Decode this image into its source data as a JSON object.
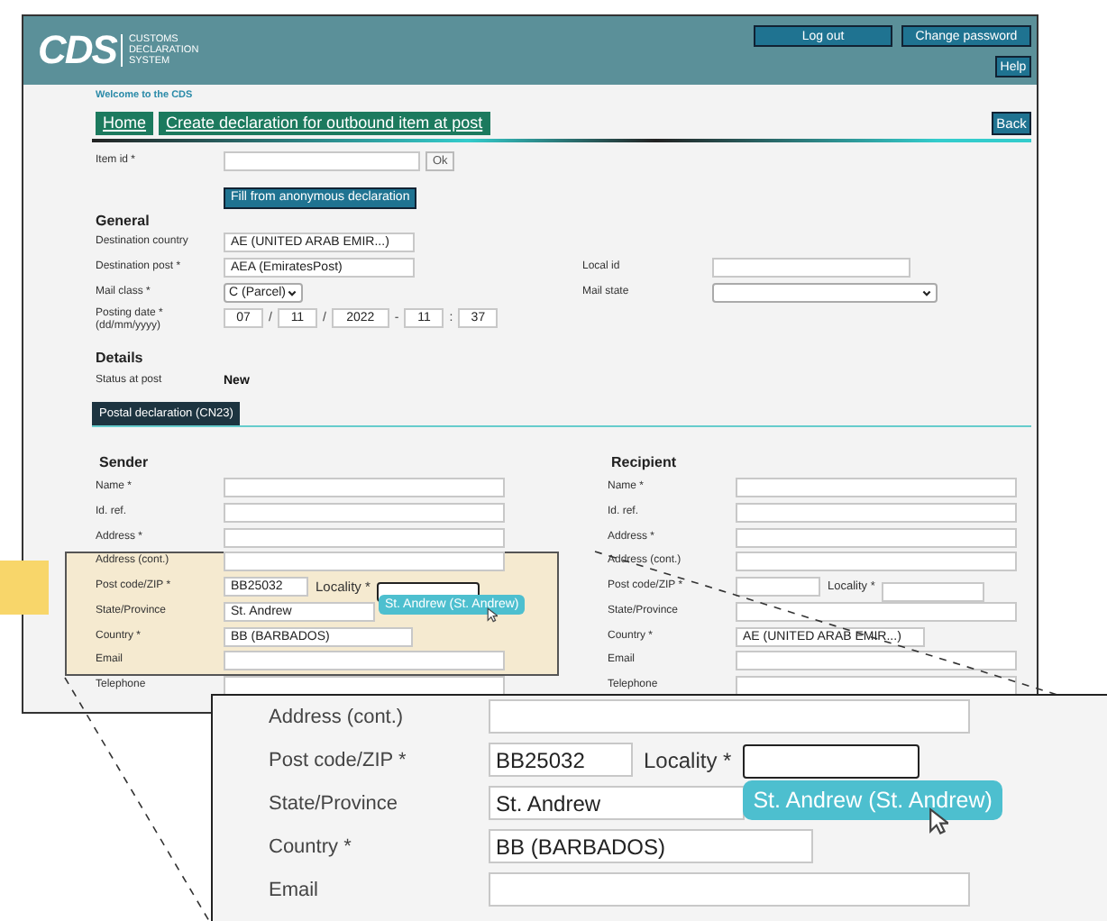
{
  "header": {
    "logo": "CDS",
    "logo_subtitle": [
      "CUSTOMS",
      "DECLARATION",
      "SYSTEM"
    ],
    "buttons": [
      "Log out",
      "Change password"
    ],
    "help": "Help"
  },
  "welcome": "Welcome to the CDS",
  "nav": {
    "links": [
      "Home",
      "Create declaration for outbound item at post"
    ],
    "back": "Back"
  },
  "item_id": {
    "label": "Item id *",
    "ok": "Ok",
    "fill_button": "Fill from anonymous declaration"
  },
  "general": {
    "heading": "General",
    "fields": [
      {
        "kind": "text",
        "label": "Destination country",
        "value": "AE (UNITED ARAB EMIR...)"
      },
      {
        "kind": "text",
        "label": "Destination post *",
        "value": "AEA (EmiratesPost)"
      },
      {
        "kind": "select",
        "label": "Mail class *",
        "value": "C (Parcel)"
      }
    ],
    "posting_date": {
      "label": "Posting date *",
      "hint": "(dd/mm/yyyy)",
      "parts": [
        "07",
        "11",
        "2022",
        "11",
        "37"
      ],
      "separators": [
        "/",
        "/",
        "-",
        ":"
      ]
    },
    "right_fields": [
      {
        "kind": "text",
        "label": "Local id"
      },
      {
        "kind": "select",
        "label": "Mail state"
      }
    ]
  },
  "details": {
    "heading": "Details",
    "status_label": "Status at post",
    "status": "New"
  },
  "tabs": [
    {
      "label": "Postal declaration (CN23)",
      "selected": true
    }
  ],
  "sender": {
    "heading": "Sender",
    "fields": [
      {
        "kind": "text",
        "label": "Name *"
      },
      {
        "kind": "text",
        "label": "Id. ref."
      },
      {
        "kind": "text",
        "label": "Address *"
      },
      {
        "kind": "text",
        "label": "Address (cont.)"
      },
      {
        "kind": "postcode",
        "label": "Post code/ZIP *",
        "value": "BB25032",
        "locality_label": "Locality *",
        "locality_focused": true,
        "suggestion": "St. Andrew (St. Andrew)"
      },
      {
        "kind": "medium",
        "label": "State/Province",
        "value": "St. Andrew"
      },
      {
        "kind": "short",
        "label": "Country *",
        "value": "BB (BARBADOS)"
      },
      {
        "kind": "text",
        "label": "Email"
      },
      {
        "kind": "text",
        "label": "Telephone"
      }
    ]
  },
  "recipient": {
    "heading": "Recipient",
    "fields": [
      {
        "kind": "text",
        "label": "Name *"
      },
      {
        "kind": "text",
        "label": "Id. ref."
      },
      {
        "kind": "text",
        "label": "Address *"
      },
      {
        "kind": "text",
        "label": "Address (cont.)"
      },
      {
        "kind": "postcode",
        "label": "Post code/ZIP *",
        "locality_label": "Locality *",
        "locality_focused": false
      },
      {
        "kind": "text",
        "label": "State/Province"
      },
      {
        "kind": "short",
        "label": "Country *",
        "value": "AE (UNITED ARAB EMIR...)"
      },
      {
        "kind": "text",
        "label": "Email"
      },
      {
        "kind": "text",
        "label": "Telephone"
      }
    ]
  },
  "callout": {
    "fields": [
      {
        "kind": "text",
        "label": "Address (cont.)"
      },
      {
        "kind": "postcode",
        "label": "Post code/ZIP *",
        "value": "BB25032",
        "locality_label": "Locality *",
        "locality_focused": true,
        "suggestion": "St. Andrew (St. Andrew)"
      },
      {
        "kind": "medium",
        "label": "State/Province",
        "value": "St. Andrew"
      },
      {
        "kind": "short",
        "label": "Country *",
        "value": "BB (BARBADOS)"
      },
      {
        "kind": "text",
        "label": "Email"
      }
    ]
  }
}
